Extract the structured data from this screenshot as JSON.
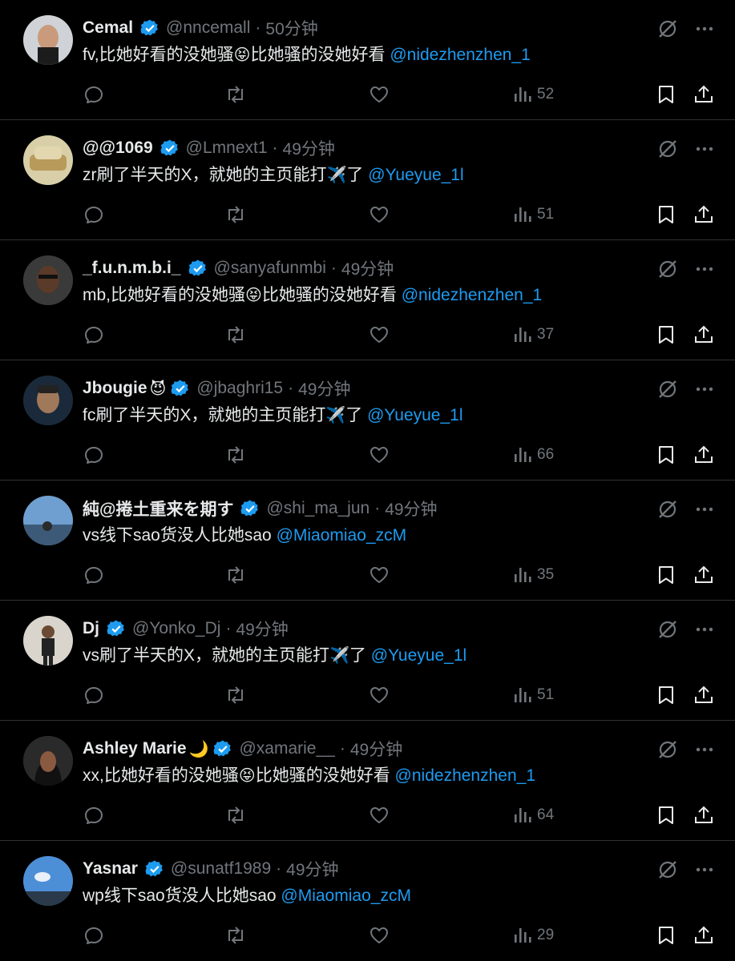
{
  "tweets": [
    {
      "name": "Cemal",
      "name_emoji": "",
      "handle": "@nncemall",
      "time": "50分钟",
      "text_prefix": "fv,比她好看的没她骚",
      "emoji": "😝",
      "text_suffix": "比她骚的没她好看 ",
      "mention": "@nidezhenzhen_1",
      "views": "52"
    },
    {
      "name": "@@1069",
      "name_emoji": "",
      "handle": "@Lmnext1",
      "time": "49分钟",
      "text_prefix": "zr刷了半天的X，就她的主页能打",
      "emoji": "✈️",
      "text_suffix": "了 ",
      "mention": "@Yueyue_1l",
      "views": "51"
    },
    {
      "name": "_f.u.n.m.b.i_",
      "name_emoji": "",
      "handle": "@sanyafunmbi",
      "time": "49分钟",
      "text_prefix": "mb,比她好看的没她骚",
      "emoji": "😝",
      "text_suffix": "比她骚的没她好看 ",
      "mention": "@nidezhenzhen_1",
      "views": "37"
    },
    {
      "name": "Jbougie",
      "name_emoji": "😈",
      "handle": "@jbaghri15",
      "time": "49分钟",
      "text_prefix": "fc刷了半天的X，就她的主页能打",
      "emoji": "✈️",
      "text_suffix": "了 ",
      "mention": "@Yueyue_1l",
      "views": "66"
    },
    {
      "name": "純@捲土重来を期す",
      "name_emoji": "",
      "handle": "@shi_ma_jun",
      "time": "49分钟",
      "text_prefix": "vs线下sao货没人比她sao ",
      "emoji": "",
      "text_suffix": "",
      "mention": "@Miaomiao_zcM",
      "views": "35"
    },
    {
      "name": "Dj",
      "name_emoji": "",
      "handle": "@Yonko_Dj",
      "time": "49分钟",
      "text_prefix": "vs刷了半天的X，就她的主页能打",
      "emoji": "✈️",
      "text_suffix": "了 ",
      "mention": "@Yueyue_1l",
      "views": "51"
    },
    {
      "name": "Ashley Marie",
      "name_emoji": "🌙",
      "handle": "@xamarie__",
      "time": "49分钟",
      "text_prefix": "xx,比她好看的没她骚",
      "emoji": "😝",
      "text_suffix": "比她骚的没她好看 ",
      "mention": "@nidezhenzhen_1",
      "views": "64"
    },
    {
      "name": "Yasnar",
      "name_emoji": "",
      "handle": "@sunatf1989",
      "time": "49分钟",
      "text_prefix": "wp线下sao货没人比她sao ",
      "emoji": "",
      "text_suffix": "",
      "mention": "@Miaomiao_zcM",
      "views": "29"
    }
  ],
  "separator": "·",
  "colors": {
    "background": "#000000",
    "text": "#e7e9ea",
    "muted": "#71767b",
    "link": "#1d9bf0",
    "border": "#2f3336",
    "verified": "#1d9bf0"
  },
  "icons": [
    "verified-badge-icon",
    "grok-icon",
    "more-icon",
    "reply-icon",
    "retweet-icon",
    "like-icon",
    "views-icon",
    "bookmark-icon",
    "share-icon"
  ]
}
